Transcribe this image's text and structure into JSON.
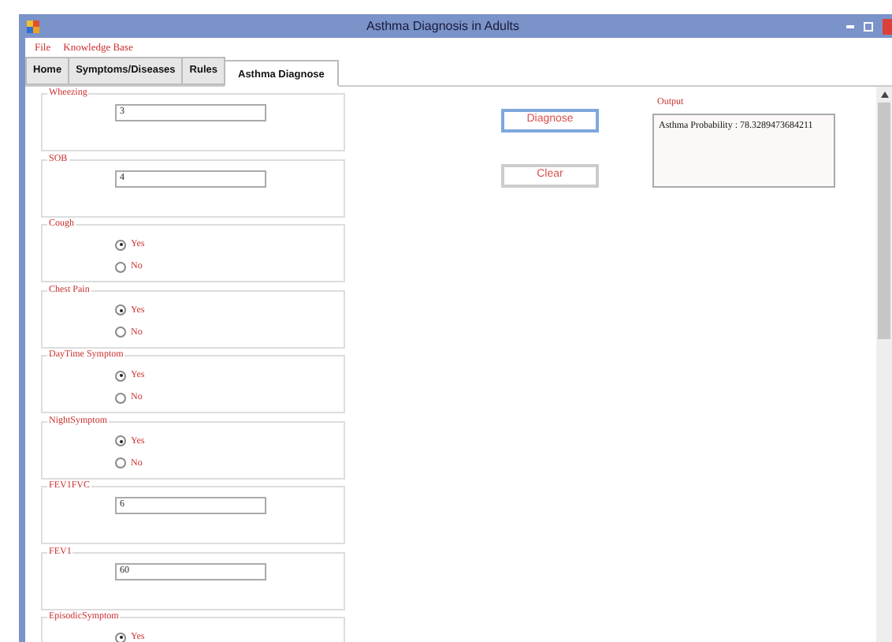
{
  "window": {
    "title": "Asthma Diagnosis in Adults"
  },
  "menu": [
    "File",
    "Knowledge Base"
  ],
  "tabs": [
    {
      "label": "Home",
      "selected": false
    },
    {
      "label": "Symptoms/Diseases",
      "selected": false
    },
    {
      "label": "Rules",
      "selected": false
    },
    {
      "label": "Asthma Diagnose",
      "selected": true
    }
  ],
  "groups": [
    {
      "kind": "text",
      "title": "Wheezing",
      "value": "3"
    },
    {
      "kind": "text",
      "title": "SOB",
      "value": "4"
    },
    {
      "kind": "radio",
      "title": "Cough",
      "options": [
        {
          "label": "Yes",
          "selected": true
        },
        {
          "label": "No",
          "selected": false
        }
      ]
    },
    {
      "kind": "radio",
      "title": "Chest Pain",
      "options": [
        {
          "label": "Yes",
          "selected": true
        },
        {
          "label": "No",
          "selected": false
        }
      ]
    },
    {
      "kind": "radio",
      "title": "DayTime Symptom",
      "options": [
        {
          "label": "Yes",
          "selected": true
        },
        {
          "label": "No",
          "selected": false
        }
      ]
    },
    {
      "kind": "radio",
      "title": "NightSymptom",
      "options": [
        {
          "label": "Yes",
          "selected": true
        },
        {
          "label": "No",
          "selected": false
        }
      ]
    },
    {
      "kind": "text",
      "title": "FEV1FVC",
      "value": "6"
    },
    {
      "kind": "text",
      "title": "FEV1",
      "value": "60"
    },
    {
      "kind": "radio",
      "title": "EpisodicSymptom",
      "options": [
        {
          "label": "Yes",
          "selected": true
        }
      ]
    }
  ],
  "buttons": [
    "Diagnose",
    "Clear"
  ],
  "output": {
    "title": "Output",
    "text": "Asthma Probability : 78.3289473684211"
  }
}
